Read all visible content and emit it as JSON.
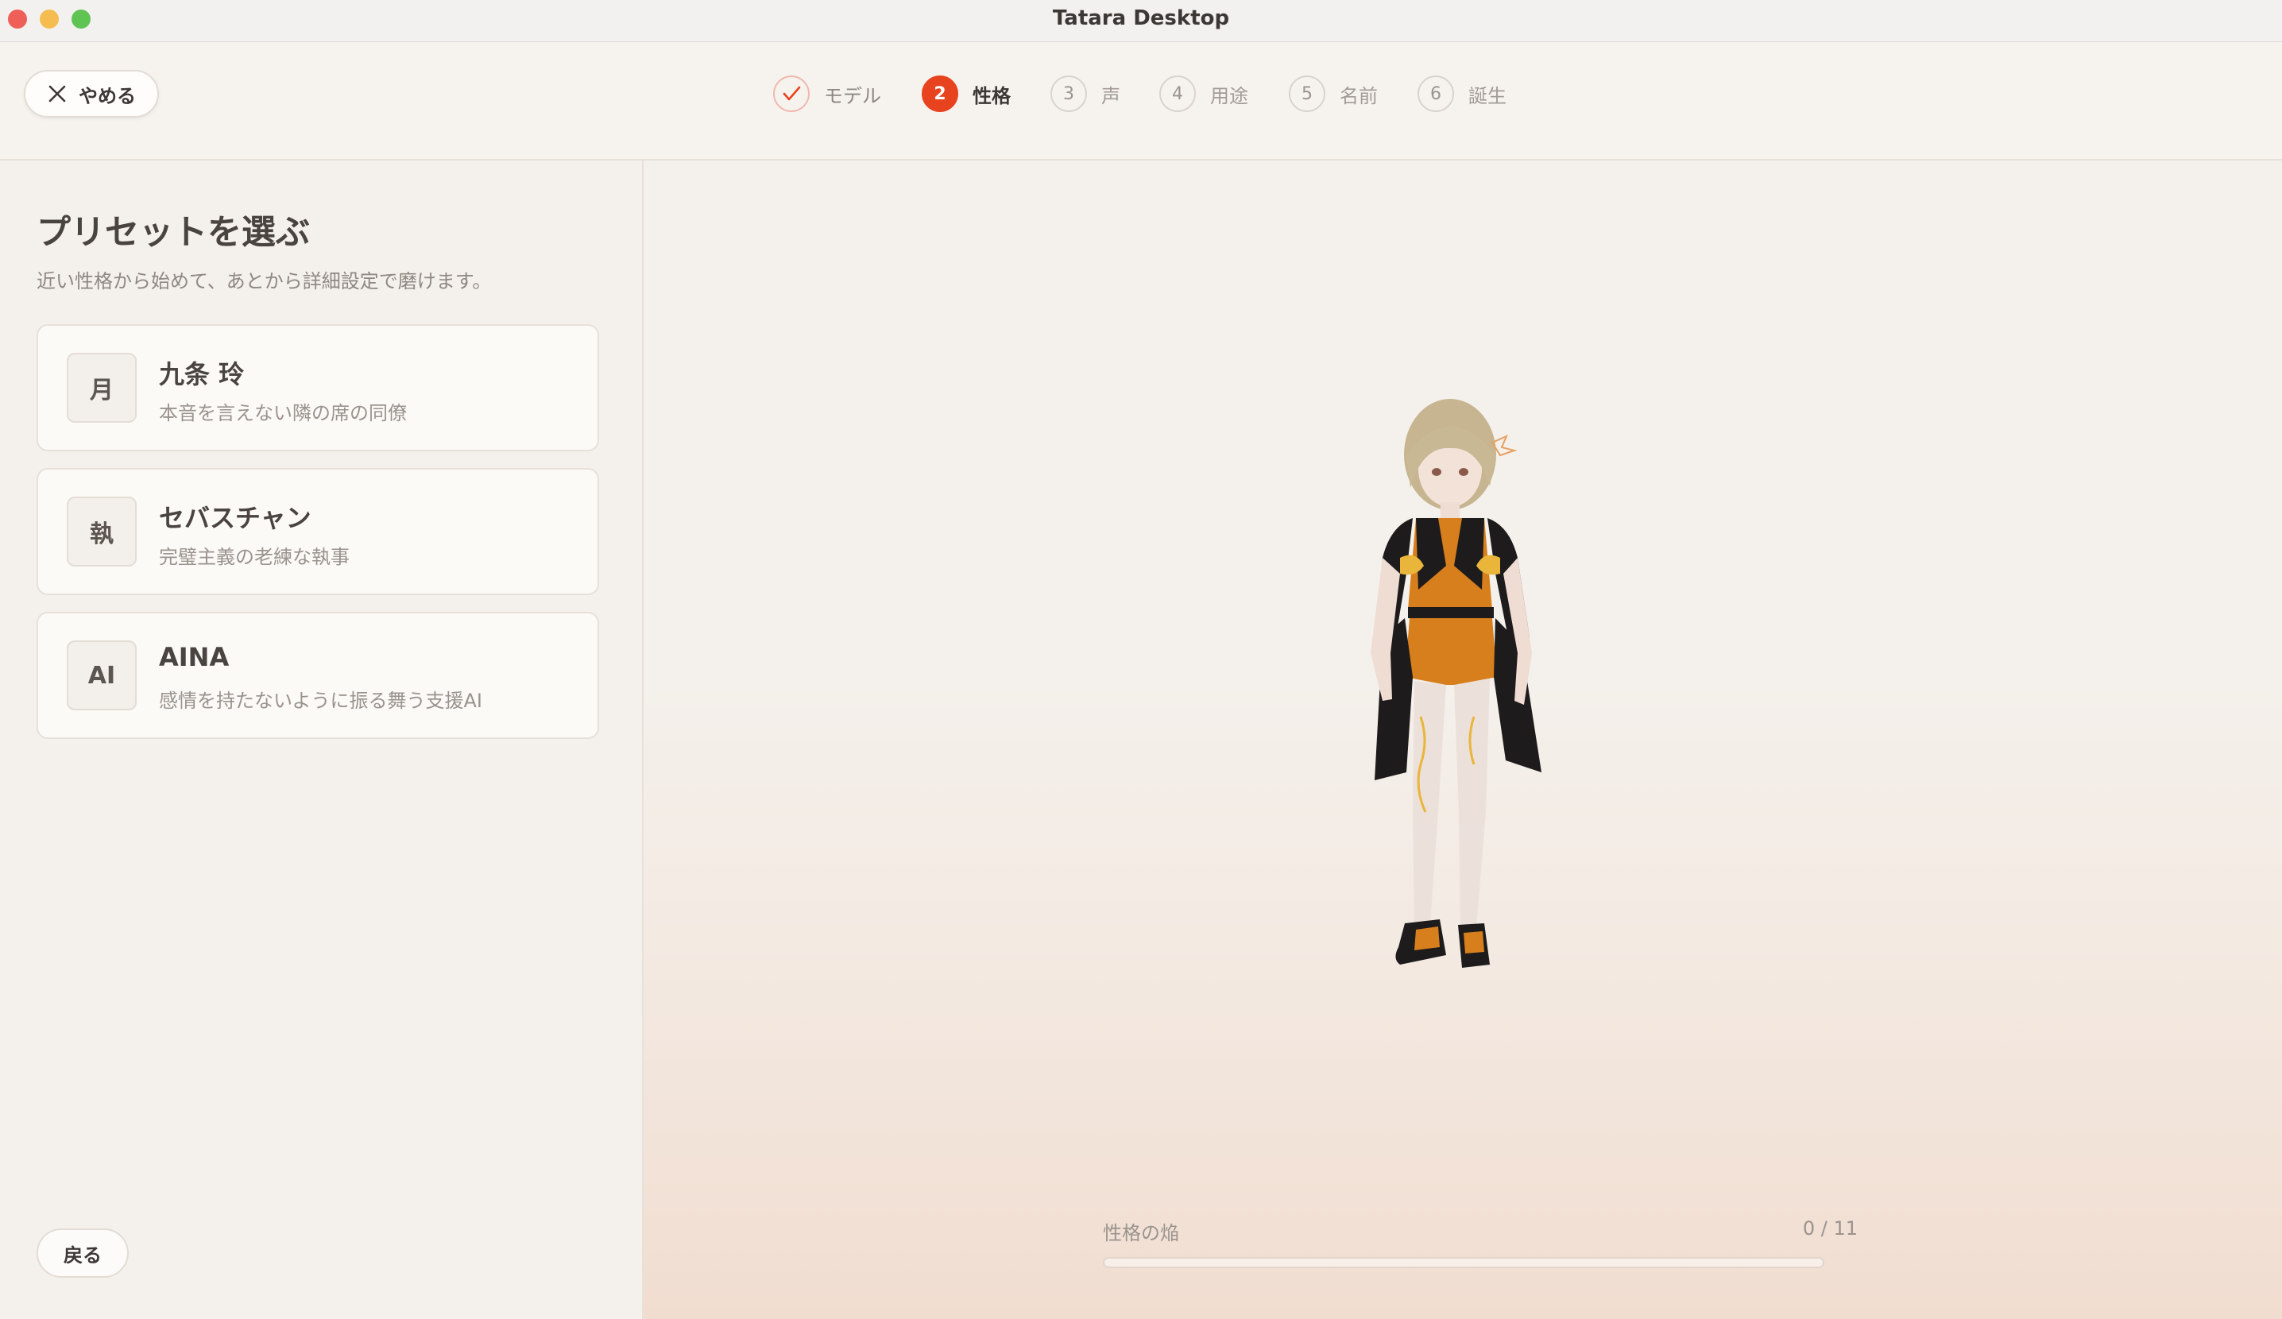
{
  "window": {
    "title": "Tatara Desktop"
  },
  "header": {
    "quit_label": "やめる",
    "steps": [
      {
        "marker": "",
        "label": "モデル",
        "state": "done"
      },
      {
        "marker": "2",
        "label": "性格",
        "state": "active"
      },
      {
        "marker": "3",
        "label": "声",
        "state": "upcoming"
      },
      {
        "marker": "4",
        "label": "用途",
        "state": "upcoming"
      },
      {
        "marker": "5",
        "label": "名前",
        "state": "upcoming"
      },
      {
        "marker": "6",
        "label": "誕生",
        "state": "upcoming"
      }
    ]
  },
  "sidebar": {
    "title": "プリセットを選ぶ",
    "subtitle": "近い性格から始めて、あとから詳細設定で磨けます。",
    "presets": [
      {
        "badge": "月",
        "name": "九条 玲",
        "description": "本音を言えない隣の席の同僚"
      },
      {
        "badge": "執",
        "name": "セバスチャン",
        "description": "完璧主義の老練な執事"
      },
      {
        "badge": "AI",
        "name": "AINA",
        "description": "感情を持たないように振る舞う支援AI"
      }
    ],
    "back_label": "戻る"
  },
  "stage": {
    "meter": {
      "label": "性格の焔",
      "count": "0 / 11",
      "value": 0,
      "max": 11
    }
  },
  "colors": {
    "accent": "#e8431f",
    "background": "#f4f0eb",
    "card": "#fcfaf7"
  }
}
